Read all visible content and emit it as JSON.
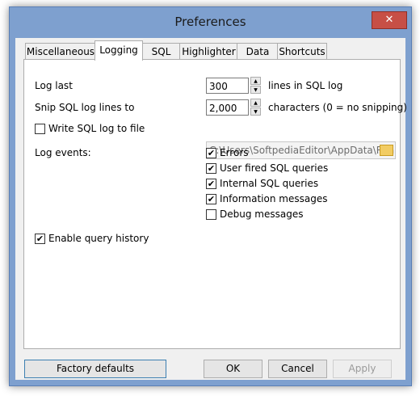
{
  "window": {
    "title": "Preferences",
    "close_glyph": "✕"
  },
  "tabs": [
    {
      "label": "Miscellaneous"
    },
    {
      "label": "Logging"
    },
    {
      "label": "SQL"
    },
    {
      "label": "Highlighter"
    },
    {
      "label": "Data"
    },
    {
      "label": "Shortcuts"
    }
  ],
  "active_tab": "Logging",
  "logging": {
    "log_last_label": "Log last",
    "log_last_value": "300",
    "log_last_suffix": "lines in SQL log",
    "snip_label": "Snip SQL log lines to",
    "snip_value": "2,000",
    "snip_suffix": "characters  (0 = no snipping)",
    "write_log_label": "Write SQL log to file",
    "write_log_checked": false,
    "log_path": "C:\\Users\\SoftpediaEditor\\AppData\\Roaming",
    "log_events_label": "Log events:",
    "events": [
      {
        "label": "Errors",
        "checked": true
      },
      {
        "label": "User fired SQL queries",
        "checked": true
      },
      {
        "label": "Internal SQL queries",
        "checked": true
      },
      {
        "label": "Information messages",
        "checked": true
      },
      {
        "label": "Debug messages",
        "checked": false
      }
    ],
    "query_history_label": "Enable query history",
    "query_history_checked": true
  },
  "buttons": {
    "factory_defaults": "Factory defaults",
    "ok": "OK",
    "cancel": "Cancel",
    "apply": "Apply"
  },
  "icons": {
    "close": "close-icon",
    "folder": "folder-icon",
    "spin_up": "▲",
    "spin_down": "▼",
    "check": "✔"
  }
}
